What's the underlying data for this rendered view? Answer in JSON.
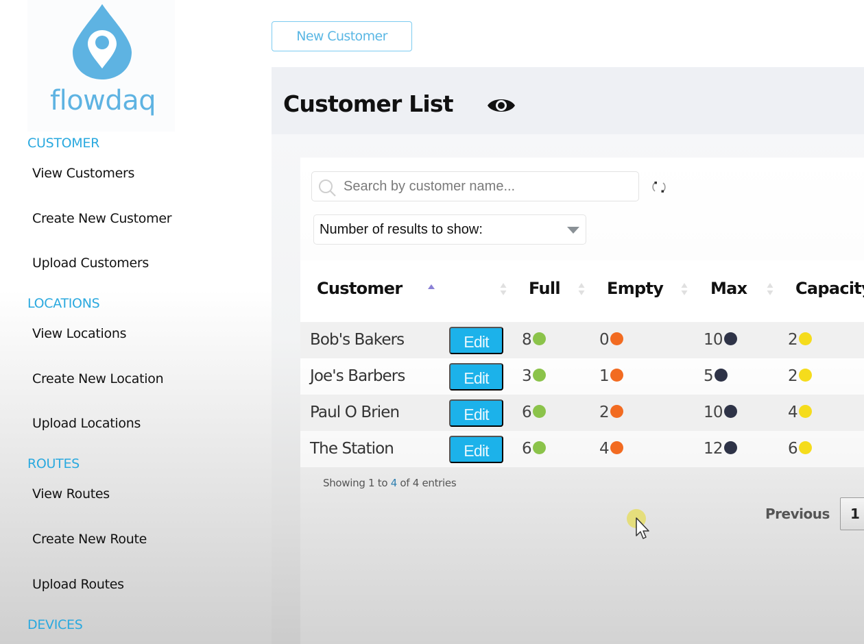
{
  "brand": {
    "name": "flowdaq",
    "color": "#5eb3e2"
  },
  "sidebar": {
    "sections": [
      {
        "title": "CUSTOMER",
        "items": [
          "View Customers",
          "Create New Customer",
          "Upload Customers"
        ]
      },
      {
        "title": "LOCATIONS",
        "items": [
          "View Locations",
          "Create New Location",
          "Upload Locations"
        ]
      },
      {
        "title": "ROUTES",
        "items": [
          "View Routes",
          "Create New Route",
          "Upload Routes"
        ]
      },
      {
        "title": "DEVICES",
        "items": []
      }
    ]
  },
  "toolbar": {
    "new_customer_label": "New Customer"
  },
  "header": {
    "title": "Customer List",
    "icon": "eye-icon"
  },
  "filters": {
    "search_placeholder": "Search by customer name...",
    "search_value": "",
    "results_label": "Number of results to show:"
  },
  "table": {
    "columns": [
      "Customer",
      "",
      "Full",
      "Empty",
      "Max",
      "Capacity"
    ],
    "sorted_column": "Customer",
    "sort_direction": "asc",
    "status_colors": {
      "full": "#8bc34a",
      "empty": "#f26b21",
      "max": "#2e3347",
      "capacity": "#f5dc1c"
    },
    "edit_label": "Edit",
    "rows": [
      {
        "customer": "Bob's Bakers",
        "full": "8",
        "empty": "0",
        "max": "10",
        "capacity": "2"
      },
      {
        "customer": "Joe's Barbers",
        "full": "3",
        "empty": "1",
        "max": "5",
        "capacity": "2"
      },
      {
        "customer": "Paul O Brien",
        "full": "6",
        "empty": "2",
        "max": "10",
        "capacity": "4"
      },
      {
        "customer": "The Station",
        "full": "6",
        "empty": "4",
        "max": "12",
        "capacity": "6"
      }
    ]
  },
  "footer": {
    "info_prefix": "Showing 1 to ",
    "info_highlight": "4",
    "info_suffix": " of 4 entries",
    "previous_label": "Previous",
    "current_page": "1"
  }
}
